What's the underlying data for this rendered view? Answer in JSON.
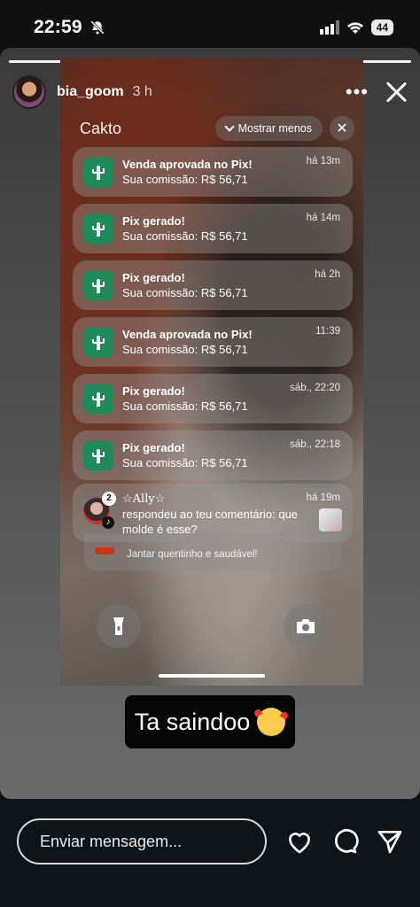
{
  "status_bar": {
    "time": "22:59",
    "battery": "44"
  },
  "story": {
    "username": "bia_goom",
    "time_ago": "3 h",
    "progress": 1.0,
    "caption": "Ta saindoo",
    "caption_emoji": "smiling-face-with-hearts"
  },
  "screenshot": {
    "group_title": "Cakto",
    "show_less_label": "Mostrar menos",
    "notifications": [
      {
        "title": "Venda aprovada no Pix!",
        "body": "Sua comissão: R$ 56,71",
        "time": "há 13m"
      },
      {
        "title": "Pix gerado!",
        "body": "Sua comissão: R$ 56,71",
        "time": "há 14m"
      },
      {
        "title": "Pix gerado!",
        "body": "Sua comissão: R$ 56,71",
        "time": "há 2h"
      },
      {
        "title": "Venda aprovada no Pix!",
        "body": "Sua comissão: R$ 56,71",
        "time": "11:39"
      },
      {
        "title": "Pix gerado!",
        "body": "Sua comissão: R$ 56,71",
        "time": "sáb., 22:20"
      },
      {
        "title": "Pix gerado!",
        "body": "Sua comissão: R$ 56,71",
        "time": "sáb., 22:18"
      }
    ],
    "tiktok_notification": {
      "name": "☆Ally☆",
      "body": "respondeu ao teu comentário: que molde é esse?",
      "time": "há 19m",
      "badge_count": "2"
    },
    "stacked_text": "Jantar quentinho e saudável!"
  },
  "bottom_bar": {
    "message_placeholder": "Enviar mensagem..."
  },
  "colors": {
    "app_icon_green": "#1c8a5a",
    "bottom_bar_bg": "#0d151b"
  }
}
